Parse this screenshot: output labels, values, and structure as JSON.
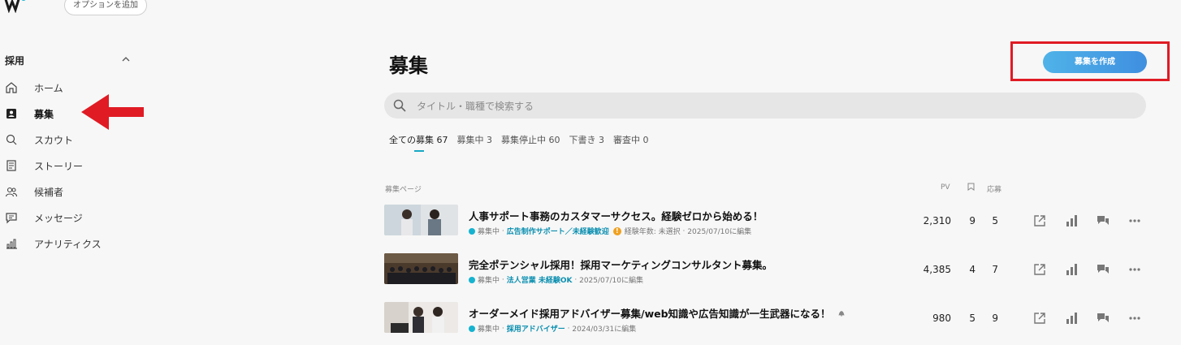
{
  "topbar": {
    "add_option": "オプションを追加"
  },
  "sidebar": {
    "section": "採用",
    "items": [
      {
        "label": "ホーム",
        "icon": "home-icon"
      },
      {
        "label": "募集",
        "icon": "job-icon",
        "active": true
      },
      {
        "label": "スカウト",
        "icon": "scout-icon"
      },
      {
        "label": "ストーリー",
        "icon": "story-icon"
      },
      {
        "label": "候補者",
        "icon": "candidates-icon"
      },
      {
        "label": "メッセージ",
        "icon": "message-icon"
      },
      {
        "label": "アナリティクス",
        "icon": "analytics-icon"
      }
    ]
  },
  "main": {
    "title": "募集",
    "create_button": "募集を作成",
    "search_placeholder": "タイトル・職種で検索する",
    "tabs": [
      "全ての募集 67",
      "募集中 3",
      "募集停止中 60",
      "下書き 3",
      "審査中 0"
    ],
    "columns": {
      "page": "募集ページ",
      "pv": "PV",
      "applications": "応募"
    },
    "rows": [
      {
        "title": "人事サポート事務のカスタマーサクセス。経験ゼロから始める！",
        "status": "募集中",
        "tag": "広告制作サポート／未経験歓迎",
        "extra": "経験年数: 未選択",
        "date": "2025/07/10に編集",
        "pv": "2,310",
        "bookmarks": "9",
        "applications": "5"
      },
      {
        "title": "完全ポテンシャル採用！採用マーケティングコンサルタント募集。",
        "status": "募集中",
        "tag": "法人営業 未経験OK",
        "date": "2025/07/10に編集",
        "pv": "4,385",
        "bookmarks": "4",
        "applications": "7"
      },
      {
        "title": "オーダーメイド採用アドバイザー募集/web知識や広告知識が一生武器になる！",
        "status": "募集中",
        "tag": "採用アドバイザー",
        "date": "2024/03/31に編集",
        "pv": "980",
        "bookmarks": "5",
        "applications": "9"
      }
    ]
  },
  "colors": {
    "accent": "#16a9c4",
    "annotation": "#e01b24",
    "button": "#3f8fe0"
  }
}
